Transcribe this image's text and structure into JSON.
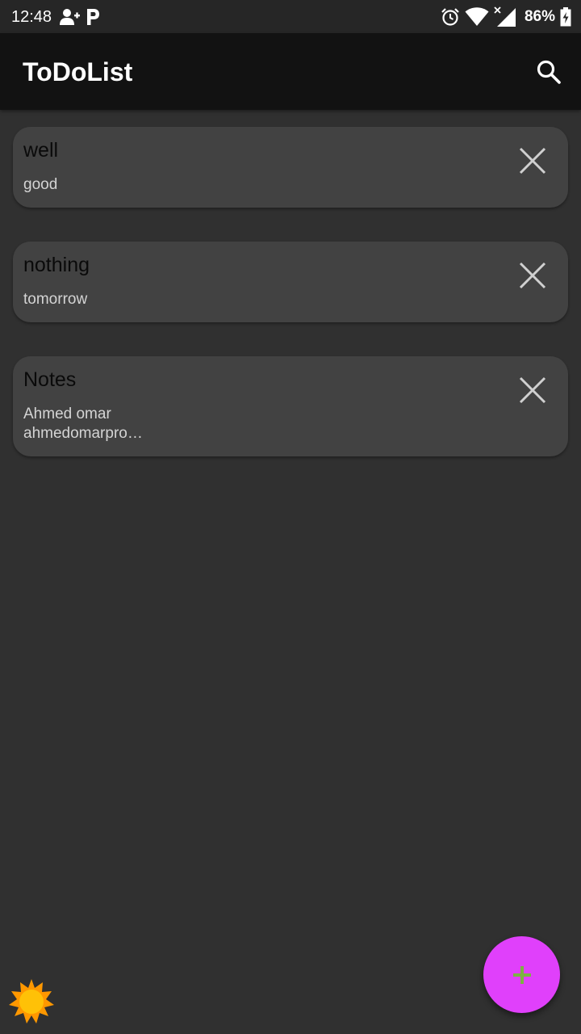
{
  "status_bar": {
    "time": "12:48",
    "battery_percent": "86%",
    "icons": [
      "add-contact-icon",
      "parking-p-icon",
      "alarm-icon",
      "wifi-icon",
      "signal-icon",
      "battery-charging-icon"
    ]
  },
  "app_bar": {
    "title": "ToDoList",
    "search_icon": "search-icon"
  },
  "notes": [
    {
      "title": "well",
      "body_lines": [
        "good"
      ]
    },
    {
      "title": "nothing",
      "body_lines": [
        "tomorrow"
      ]
    },
    {
      "title": "Notes",
      "body_lines": [
        "Ahmed omar",
        "ahmedomarpro…"
      ]
    }
  ],
  "theme_toggle": {
    "icon": "sun-icon"
  },
  "fab": {
    "icon": "plus-icon"
  },
  "colors": {
    "background": "#303030",
    "status_bar": "#262626",
    "app_bar": "#121212",
    "card": "#424242",
    "fab": "#e040fb",
    "fab_icon": "#7cb342",
    "sun": "#ffc107"
  }
}
